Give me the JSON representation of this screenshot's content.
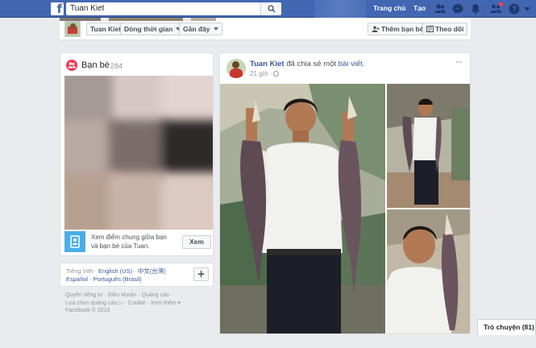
{
  "topbar": {
    "search_value": "Tuan Kiet",
    "home_label": "Trang chủ",
    "create_label": "Tạo"
  },
  "profile_header": {
    "name_button": "Tuan Kiet",
    "timeline_button": "Dòng thời gian",
    "recent_button": "Gần đây",
    "add_friend_button": "Thêm bạn bè",
    "follow_button": "Theo dõi"
  },
  "friends": {
    "title": "Bạn bè",
    "count": "284",
    "mutual_text": "Xem điểm chung giữa bạn và bạn bè của Tuan.",
    "view_button": "Xem"
  },
  "languages": {
    "current": "Tiếng Việt",
    "sep": " · ",
    "items": [
      "English (US)",
      "中文(台灣)",
      "Español",
      "Português (Brasil)"
    ]
  },
  "footer": {
    "line1": "Quyền riêng tư · Điều khoản · Quảng cáo ·",
    "line2": "Lựa chọn quảng cáo ▷ · Cookie · Xem thêm ▾",
    "line3": "Facebook © 2018"
  },
  "post": {
    "author": "Tuan Kiet",
    "action_text": " đã chia sẻ một ",
    "object_link": "bài viết",
    "object_suffix": ".",
    "time": "21 giờ ·",
    "more_label": "···"
  },
  "chat": {
    "label": "Trò chuyện (81)"
  },
  "colors": {
    "brand": "#4267b2",
    "link": "#385898",
    "background": "#e9ebee"
  }
}
